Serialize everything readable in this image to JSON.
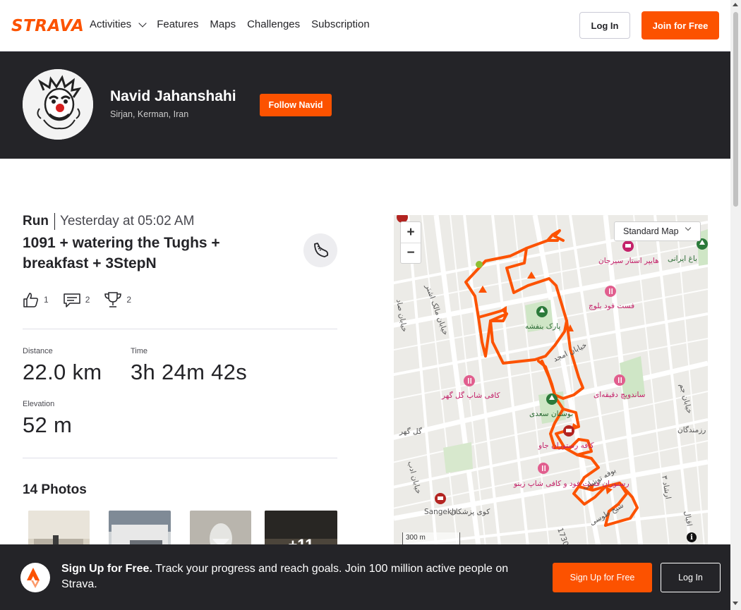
{
  "nav": {
    "logo": "STRAVA",
    "items": [
      {
        "label": "Activities",
        "dropdown": true
      },
      {
        "label": "Features"
      },
      {
        "label": "Maps"
      },
      {
        "label": "Challenges"
      },
      {
        "label": "Subscription"
      }
    ],
    "login_label": "Log In",
    "join_label": "Join for Free"
  },
  "profile": {
    "name": "Navid Jahanshahi",
    "location": "Sirjan, Kerman, Iran",
    "follow_label": "Follow Navid"
  },
  "activity": {
    "type": "Run",
    "time": "Yesterday at 05:02 AM",
    "title": "1091 + watering the Tughs + breakfast + 3StepN",
    "kudos": "1",
    "comments": "2",
    "achievements": "2",
    "stats": {
      "distance_label": "Distance",
      "distance_value": "22.0 km",
      "time_label": "Time",
      "time_value": "3h 24m 42s",
      "elevation_label": "Elevation",
      "elevation_value": "52 m"
    },
    "photos_title": "14 Photos",
    "more_photos": "+11"
  },
  "map": {
    "style_label": "Standard Map",
    "zoom_in": "+",
    "zoom_out": "−",
    "scale": "300 m",
    "info": "i",
    "route_color": "#fc5200",
    "labels": [
      "هایپر استار سیرجان",
      "فست فود بلوچ",
      "پارک بنفشه",
      "خیابان امجد",
      "ساندویچ دقیقه‌ای",
      "کافی شاپ گل گهر",
      "بوستان سعدی",
      "کافه رستوران جاو",
      "رستوران فست فود و کافی شاپ زینو",
      "Sangekh",
      "کوی پزشکان",
      "خیابان مالک اشتر",
      "گل گهر",
      "خیابان ادب",
      "خیابان جم",
      "ارشاد ۳",
      "باغ ایرانی",
      "رزمندگان",
      "بوفه توشاب",
      "شیخ طوسی",
      "خیابان صاد",
      "اقبال",
      "1730"
    ]
  },
  "banner": {
    "headline": "Sign Up for Free.",
    "text": "Track your progress and reach goals. Join 100 million active people on Strava.",
    "signup_label": "Sign Up for Free",
    "login_label": "Log In"
  },
  "colors": {
    "brand": "#fc5200",
    "dark": "#242428"
  }
}
